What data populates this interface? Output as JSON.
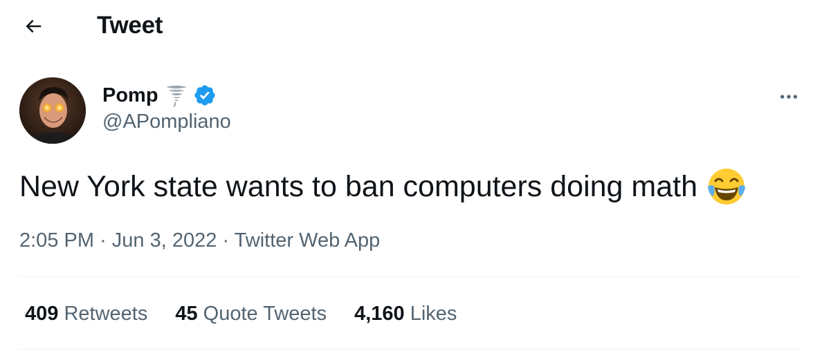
{
  "header": {
    "title": "Tweet",
    "back_icon": "arrow-left-icon"
  },
  "author": {
    "display_name": "Pomp",
    "name_emoji": "tornado-icon",
    "verified": true,
    "verified_color": "#1d9bf0",
    "handle": "@APompliano",
    "avatar": "avatar"
  },
  "more_icon": "more-horizontal-icon",
  "tweet": {
    "text": "New York state wants to ban computers doing math",
    "emoji": "face-with-tears-of-joy-icon"
  },
  "meta": {
    "time": "2:05 PM",
    "separator": "·",
    "date": "Jun 3, 2022",
    "source": "Twitter Web App"
  },
  "stats": {
    "retweets_count": "409",
    "retweets_label": "Retweets",
    "quotes_count": "45",
    "quotes_label": "Quote Tweets",
    "likes_count": "4,160",
    "likes_label": "Likes"
  },
  "colors": {
    "text_primary": "#0f1419",
    "text_secondary": "#536471",
    "divider": "#eff3f4",
    "accent": "#1d9bf0"
  }
}
